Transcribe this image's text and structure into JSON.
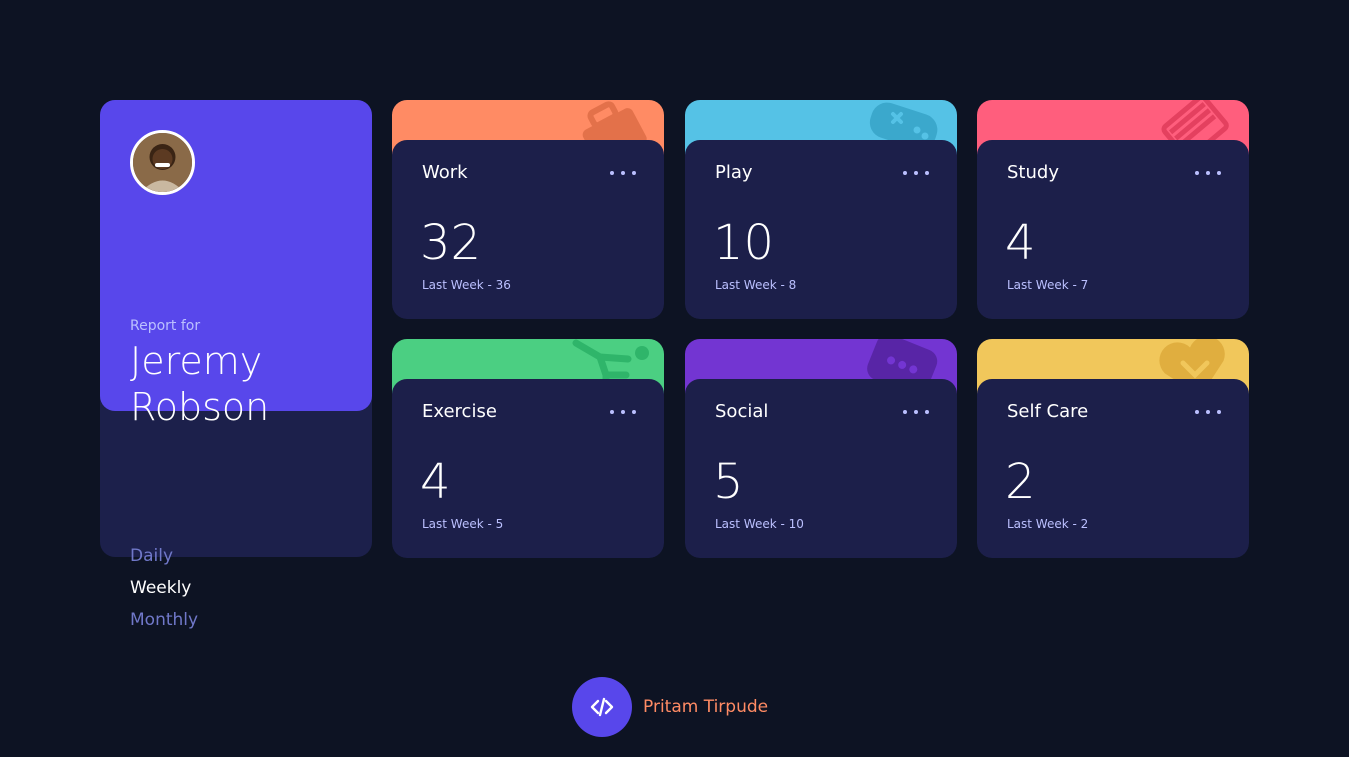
{
  "profile": {
    "report_label": "Report for",
    "name": "Jeremy Robson",
    "periods": [
      "Daily",
      "Weekly",
      "Monthly"
    ],
    "active_period": "Weekly",
    "accent": "#5847eb"
  },
  "activities": [
    {
      "title": "Work",
      "current": "32",
      "previous": "Last Week - 36",
      "color": "#ff8b64",
      "icon": "briefcase-icon"
    },
    {
      "title": "Play",
      "current": "10",
      "previous": "Last Week - 8",
      "color": "#55c2e6",
      "icon": "gamepad-icon"
    },
    {
      "title": "Study",
      "current": "4",
      "previous": "Last Week - 7",
      "color": "#ff5e7d",
      "icon": "book-icon"
    },
    {
      "title": "Exercise",
      "current": "4",
      "previous": "Last Week - 5",
      "color": "#4bcf82",
      "icon": "running-icon"
    },
    {
      "title": "Social",
      "current": "5",
      "previous": "Last Week - 10",
      "color": "#7335d2",
      "icon": "chat-icon"
    },
    {
      "title": "Self Care",
      "current": "2",
      "previous": "Last Week - 2",
      "color": "#f1c75b",
      "icon": "heart-icon"
    }
  ],
  "footer": {
    "author": "Pritam Tirpude",
    "icon": "code-icon"
  }
}
